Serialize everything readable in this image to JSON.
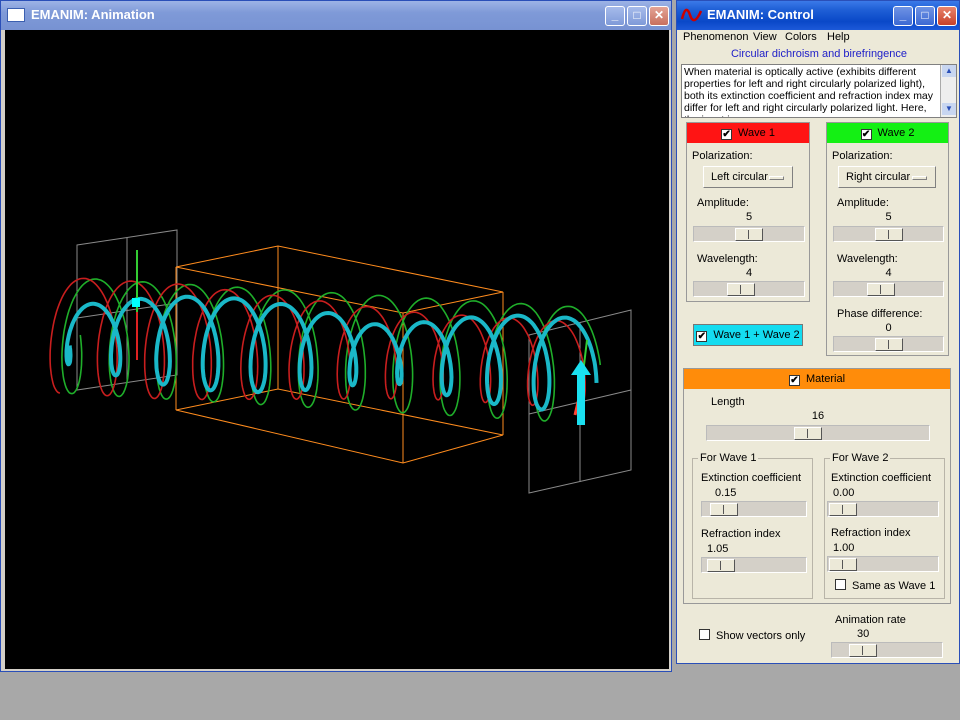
{
  "anim_window": {
    "title": "EMANIM: Animation"
  },
  "control_window": {
    "title": "EMANIM: Control",
    "menu": [
      "Phenomenon",
      "View",
      "Colors",
      "Help"
    ],
    "phenomenon_title": "Circular dichroism and birefringence",
    "description": "When material is optically active (exhibits different properties for left and right circularly polarized light), both its extinction coefficient and refraction index may differ for left and right circularly polarized light. Here, the input is a"
  },
  "wave1": {
    "label": "Wave 1",
    "checked": true,
    "color": "#ff1414",
    "polarization_label": "Polarization:",
    "polarization": "Left circular",
    "amplitude_label": "Amplitude:",
    "amplitude": "5",
    "amplitude_pos": 0.5,
    "wavelength_label": "Wavelength:",
    "wavelength": "4",
    "wavelength_pos": 0.4
  },
  "wave2": {
    "label": "Wave 2",
    "checked": true,
    "color": "#14f014",
    "polarization_label": "Polarization:",
    "polarization": "Right circular",
    "amplitude_label": "Amplitude:",
    "amplitude": "5",
    "amplitude_pos": 0.5,
    "wavelength_label": "Wavelength:",
    "wavelength": "4",
    "wavelength_pos": 0.4,
    "phase_label": "Phase difference:",
    "phase": "0",
    "phase_pos": 0.5
  },
  "sum_wave": {
    "label": "Wave 1 + Wave 2",
    "checked": true,
    "color": "#14dcf0"
  },
  "material": {
    "label": "Material",
    "checked": true,
    "color": "#ff8c0a",
    "length_label": "Length",
    "length": "16",
    "length_pos": 0.45,
    "for_wave1": {
      "title": "For Wave 1",
      "ext_label": "Extinction coefficient",
      "ext": "0.15",
      "ext_pos": 0.1,
      "ref_label": "Refraction index",
      "ref": "1.05",
      "ref_pos": 0.05
    },
    "for_wave2": {
      "title": "For Wave 2",
      "ext_label": "Extinction coefficient",
      "ext": "0.00",
      "ext_pos": 0.0,
      "ref_label": "Refraction index",
      "ref": "1.00",
      "ref_pos": 0.0,
      "same_label": "Same as Wave 1",
      "same_checked": false
    }
  },
  "show_vectors": {
    "label": "Show vectors only",
    "checked": false
  },
  "animation_rate": {
    "label": "Animation rate",
    "value": "30",
    "pos": 0.2
  }
}
